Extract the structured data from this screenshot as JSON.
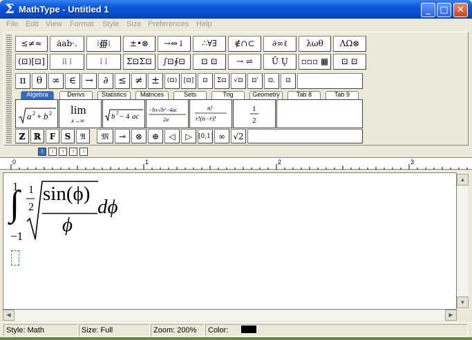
{
  "window": {
    "app_icon": "Σ",
    "title": "MathType - Untitled 1",
    "controls": {
      "minimize": "_",
      "maximize": "□",
      "close": "✕"
    }
  },
  "menu": [
    "File",
    "Edit",
    "View",
    "Format",
    "Style",
    "Size",
    "Preferences",
    "Help"
  ],
  "symbol_palette_row1": [
    "≤≠≈",
    "ȧab·.",
    "⁞∰⁞",
    "±•⊗",
    "→⇔↓",
    "∴∀∃",
    "∉∩⊂",
    "∂∞ℓ",
    "λωθ",
    "ΛΩ⊗"
  ],
  "symbol_palette_row2": [
    "(⊡)[⊡]",
    "⁞⁞ ⁞",
    "⁞ ⁞",
    "Σ⊡Σ⊡",
    "∫⊡∮⊡",
    "⊡ ⊡",
    "→ ⇌",
    "Ū Ų",
    "▫▫▫ ▦",
    "⊡ ⊡"
  ],
  "symbol_bar": [
    "π",
    "θ",
    "∞",
    "∈",
    "→",
    "∂",
    "≤",
    "≠",
    "±",
    "(⊡)",
    "[⊡]",
    "⊡",
    "Σ⊡",
    "√⊡",
    "⊡'",
    "⊡.",
    "⊡"
  ],
  "tabs": [
    "Algebra",
    "Derivs",
    "Statistics",
    "Matrices",
    "Sets",
    "Trig",
    "Geometry",
    "Tab 8",
    "Tab 9"
  ],
  "active_tab": "Algebra",
  "templates": [
    {
      "label": "√(a²+b²)"
    },
    {
      "label": "lim x→∞"
    },
    {
      "label": "√(b²−4ac)"
    },
    {
      "label": "(−b±√(b²−4ac))/2a"
    },
    {
      "label": "n!/(r!(n−r)!)"
    },
    {
      "label": "1/2"
    }
  ],
  "small_bar": [
    "ℤ",
    "ℝ",
    "F",
    "S",
    "𝔄",
    "𝔐",
    "⊸",
    "⊗",
    "⊕",
    "◁",
    "▷",
    "[0,1]",
    "∞",
    "√2"
  ],
  "view_buttons": [
    "t",
    "↑",
    "↑",
    "↑",
    "↑"
  ],
  "ruler": {
    "labels": [
      "0",
      "1",
      "2",
      "3"
    ]
  },
  "equation": {
    "upper_limit": "1",
    "lower_limit": "−1",
    "integral": "∫",
    "root_index_num": "1",
    "root_index_den": "2",
    "numerator": "sin(ϕ)",
    "denominator": "ϕ",
    "differential": "dϕ"
  },
  "status": {
    "style": "Style: Math",
    "size": "Size: Full",
    "zoom": "Zoom: 200%",
    "color_label": "Color:",
    "color_value": "#000000"
  }
}
